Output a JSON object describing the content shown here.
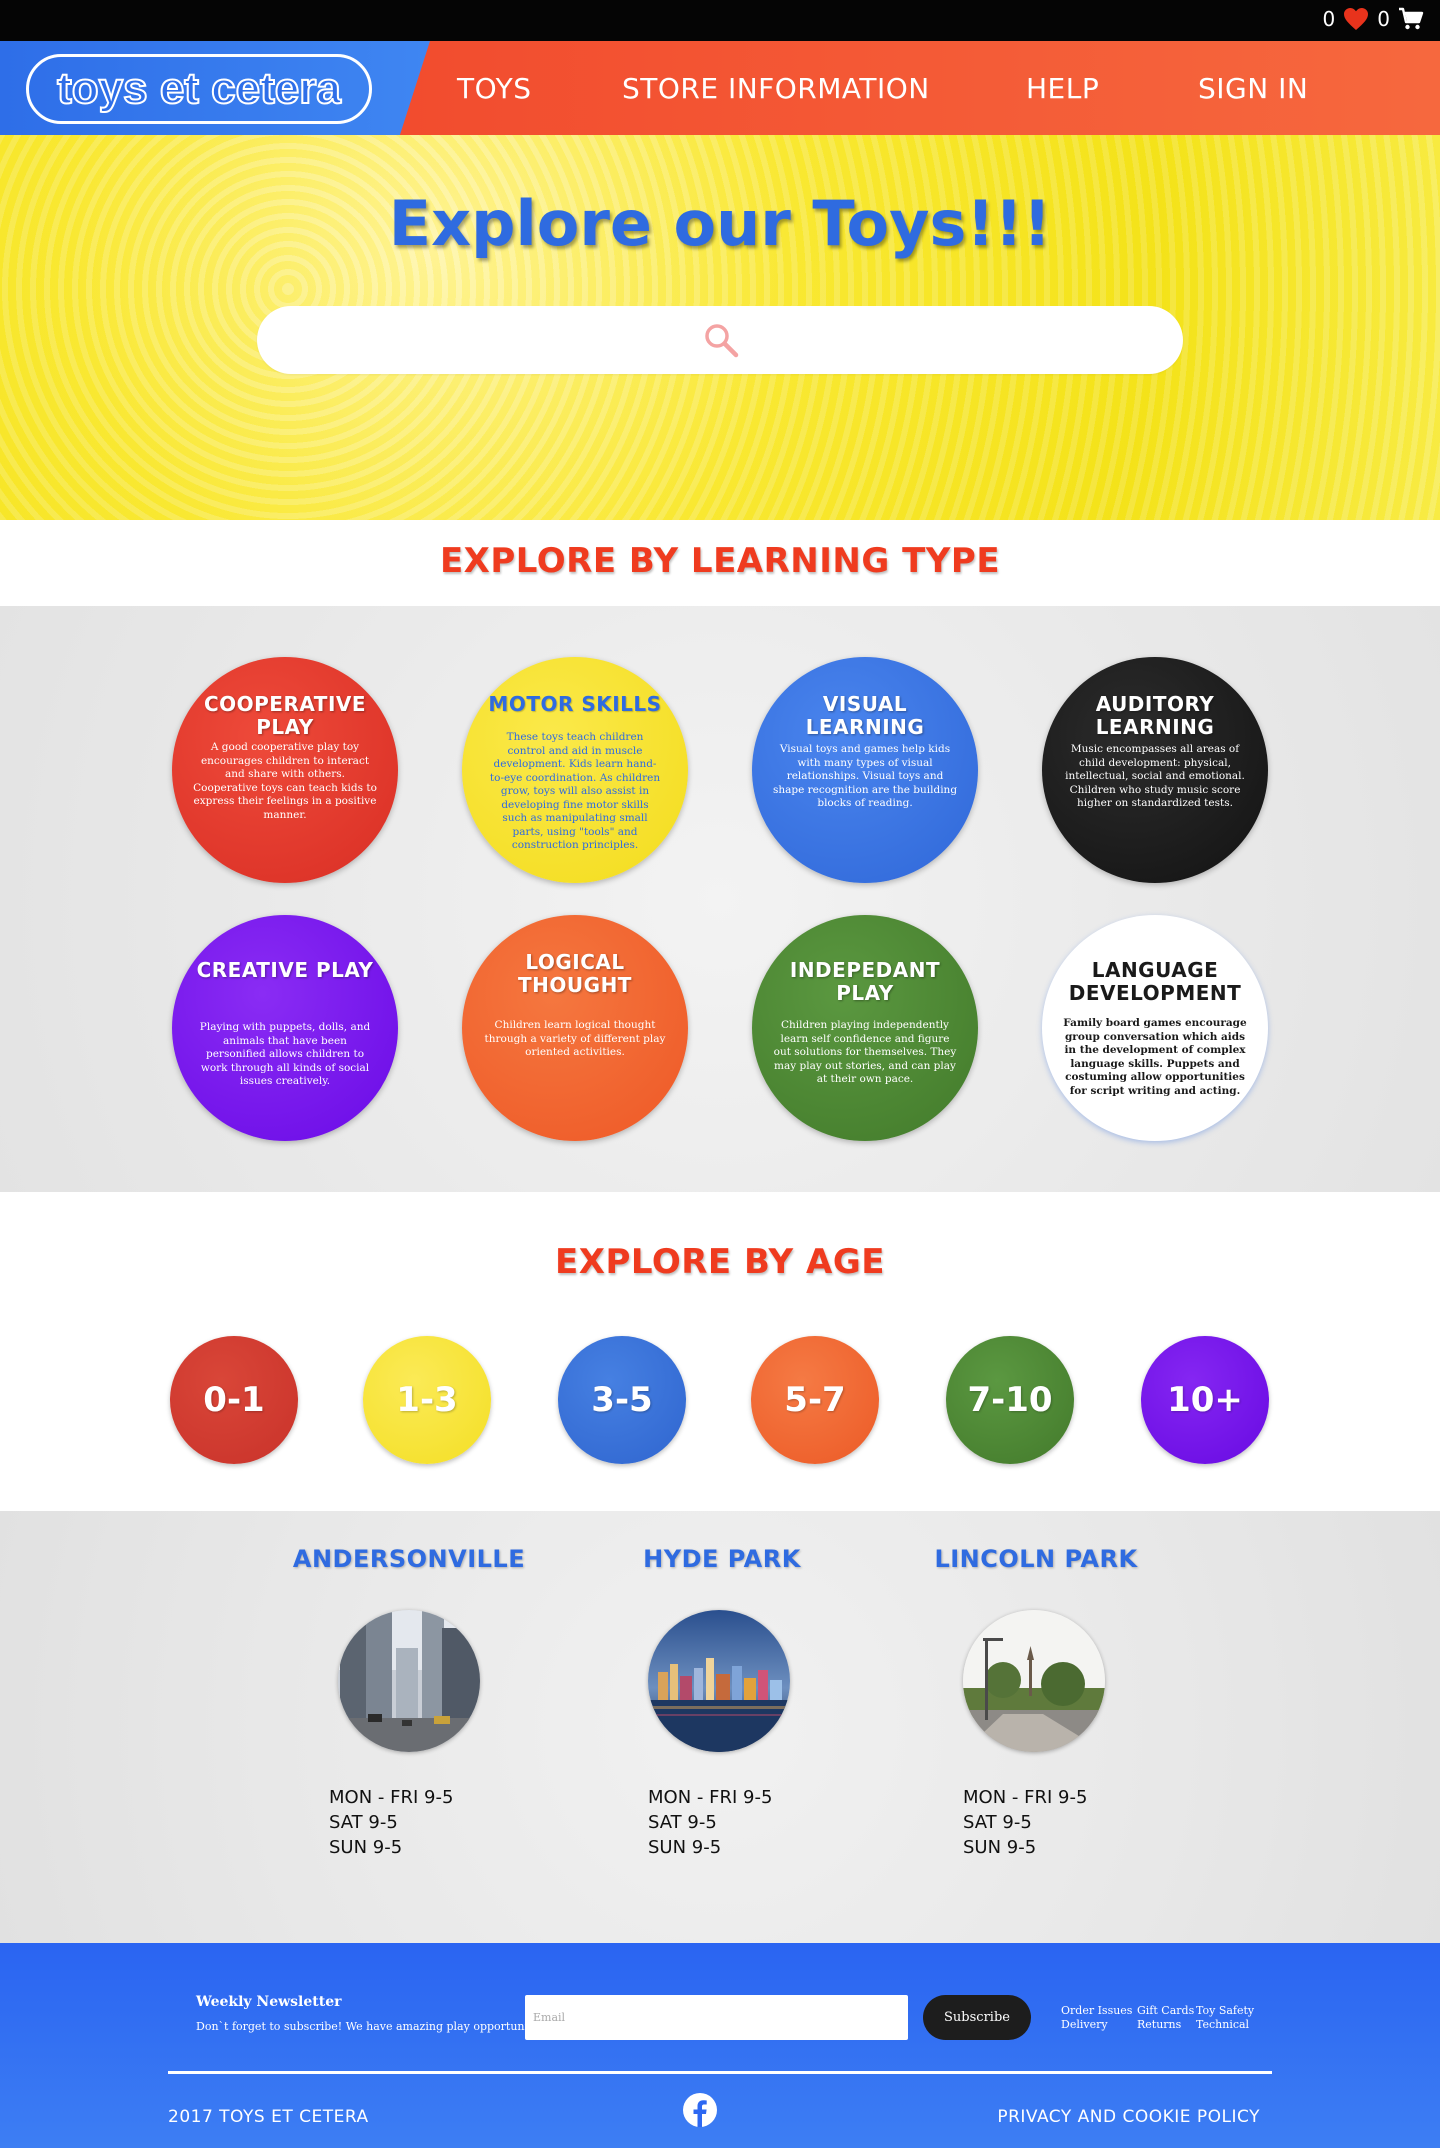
{
  "topbar": {
    "wishlist_count": "0",
    "cart_count": "0",
    "icons": [
      "heart-icon",
      "cart-icon"
    ]
  },
  "header": {
    "logo": "toys et cetera",
    "nav": [
      "TOYS",
      "STORE INFORMATION",
      "HELP",
      "SIGN IN"
    ]
  },
  "hero": {
    "title": "Explore our Toys!!!",
    "search_placeholder": "",
    "search_icon": "search-icon"
  },
  "learning": {
    "heading": "EXPLORE BY LEARNING TYPE",
    "items": [
      {
        "title": "COOPERATIVE PLAY",
        "desc": "A good cooperative play toy encourages children to interact and share with others. Cooperative toys can teach kids to express their feelings in a positive manner.",
        "color": "#e2382e"
      },
      {
        "title": "MOTOR SKILLS",
        "desc": "These toys teach children control and aid in muscle development. Kids learn hand-to-eye coordination. As children grow, toys will also assist in developing fine motor skills such as manipulating small parts, using \"tools\" and construction principles.",
        "color": "#f7e432"
      },
      {
        "title": "VISUAL LEARNING",
        "desc": "Visual toys and games help kids with many types of visual relationships. Visual toys and shape recognition are the building blocks of reading.",
        "color": "#3673e3"
      },
      {
        "title": "AUDITORY LEARNING",
        "desc": "Music encompasses all areas of child development: physical, intellectual, social and emotional. Children who study music score higher on standardized tests.",
        "color": "#1c1c1c"
      },
      {
        "title": "CREATIVE PLAY",
        "desc": "Playing with puppets, dolls, and animals that have been personified allows children to work through all kinds of social issues creatively.",
        "color": "#7a12f0"
      },
      {
        "title": "LOGICAL THOUGHT",
        "desc": "Children learn logical thought through a variety of different play oriented activities.",
        "color": "#f2652f"
      },
      {
        "title": "INDEPEDANT PLAY",
        "desc": "Children playing independently learn self confidence and figure out solutions for themselves. They may play out stories, and can play at their own pace.",
        "color": "#4f8a34"
      },
      {
        "title": "LANGUAGE DEVELOPMENT",
        "desc": "Family board games encourage group conversation which aids in the development of complex language skills. Puppets and costuming allow opportunities for script writing and acting.",
        "color": "#ffffff"
      }
    ]
  },
  "ages": {
    "heading": "EXPLORE BY AGE",
    "items": [
      {
        "label": "0-1",
        "color": "#d13a2c"
      },
      {
        "label": "1-3",
        "color": "#f8e63d"
      },
      {
        "label": "3-5",
        "color": "#3a72d8"
      },
      {
        "label": "5-7",
        "color": "#f26832"
      },
      {
        "label": "7-10",
        "color": "#4d8833"
      },
      {
        "label": "10+",
        "color": "#7613ec"
      }
    ]
  },
  "locations": [
    {
      "name": "ANDERSONVILLE",
      "hours": [
        "MON - FRI 9-5",
        "SAT 9-5",
        "SUN 9-5"
      ]
    },
    {
      "name": "HYDE PARK",
      "hours": [
        "MON - FRI 9-5",
        "SAT 9-5",
        "SUN 9-5"
      ]
    },
    {
      "name": "LINCOLN PARK",
      "hours": [
        "MON - FRI 9-5",
        "SAT 9-5",
        "SUN 9-5"
      ]
    }
  ],
  "footer": {
    "newsletter_title": "Weekly Newsletter",
    "newsletter_sub": "Don`t forget to subscribe! We have amazing play opportunities!",
    "email_placeholder": "Email",
    "subscribe": "Subscribe",
    "links": [
      "Order Issues",
      "Delivery",
      "Gift Cards",
      "Returns",
      "Toy Safety",
      "Technical"
    ],
    "copyright": "2017 TOYS ET CETERA",
    "privacy": "PRIVACY AND COOKIE POLICY",
    "social_icon": "facebook-icon"
  }
}
